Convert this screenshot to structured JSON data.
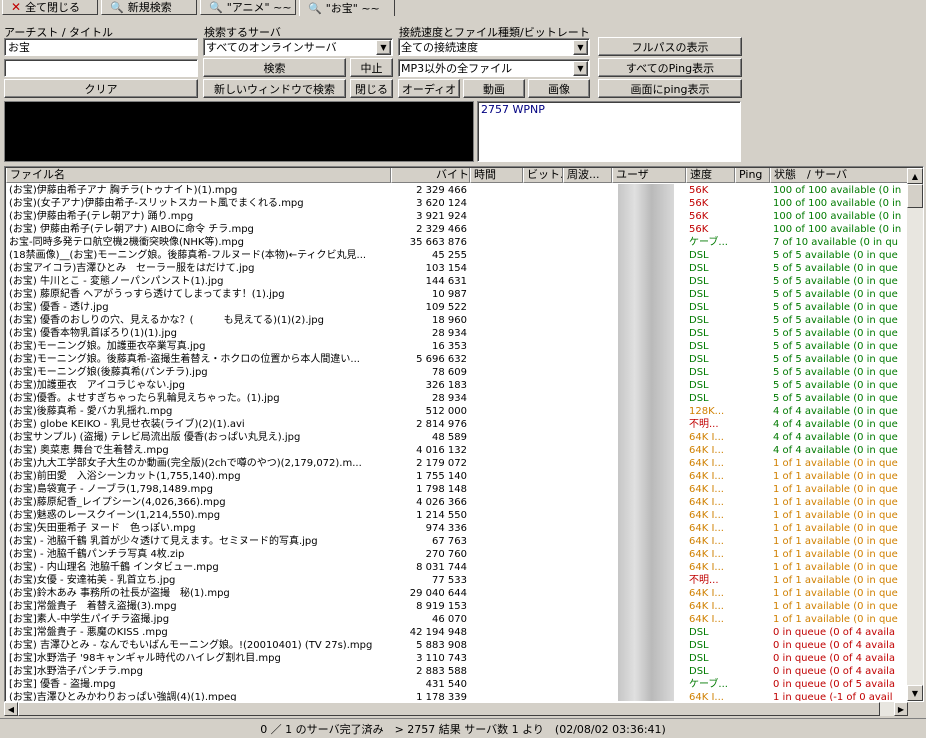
{
  "tabs": [
    {
      "label": "全て閉じる",
      "icon": "close-icon"
    },
    {
      "label": "新規検索",
      "icon": "search-icon"
    },
    {
      "label": "\"アニメ\" ~~",
      "icon": "search-icon"
    },
    {
      "label": "\"お宝\" ~~",
      "icon": "search-icon"
    }
  ],
  "search": {
    "artist_label": "アーチスト / タイトル",
    "artist_value": "お宝",
    "secondary_value": "",
    "clear_button": "クリア",
    "server_label": "検索するサーバ",
    "server_value": "すべてのオンラインサーバ",
    "search_button": "検索",
    "stop_button": "中止",
    "new_window_button": "新しいウィンドウで検索",
    "close_button": "閉じる",
    "speed_label": "接続速度とファイル種類/ビットレート",
    "speed_value": "全ての接続速度",
    "filetype_value": "MP3以外の全ファイル",
    "audio_button": "オーディオ",
    "video_button": "動画",
    "image_button": "画像",
    "fullpath_button": "フルパスの表示",
    "ping_all_button": "すべてのPing表示",
    "ping_screen_button": "画面にping表示",
    "info_text": "2757 WPNP"
  },
  "columns": [
    "ファイル名",
    "バイト",
    "時間",
    "ビット...",
    "周波...",
    "ユーザ",
    "速度",
    "Ping",
    "状態　/ サーバ"
  ],
  "colors": {
    "red": "#c00000",
    "green": "#007a00",
    "orange": "#d08000"
  },
  "rows": [
    {
      "name": "(お宝)伊藤由希子アナ 胸チラ(トゥナイト)(1).mpg",
      "size": "2 329 466",
      "speed": "56K",
      "speed_color": "red",
      "status": "100 of 100 available (0 in",
      "status_color": "green"
    },
    {
      "name": "(お宝)(女子アナ)伊藤由希子-スリットスカート風でまくれる.mpg",
      "size": "3 620 124",
      "speed": "56K",
      "speed_color": "red",
      "status": "100 of 100 available (0 in",
      "status_color": "green"
    },
    {
      "name": "(お宝)伊藤由希子(テレ朝アナ) 踊り.mpg",
      "size": "3 921 924",
      "speed": "56K",
      "speed_color": "red",
      "status": "100 of 100 available (0 in",
      "status_color": "green"
    },
    {
      "name": "(お宝) 伊藤由希子(テレ朝アナ) AIBOに命令 チラ.mpg",
      "size": "2 329 466",
      "speed": "56K",
      "speed_color": "red",
      "status": "100 of 100 available (0 in",
      "status_color": "green"
    },
    {
      "name": "お宝-同時多発テロ航空機2機衝突映像(NHK等).mpg",
      "size": "35 663 876",
      "speed": "ケーブ...",
      "speed_color": "green",
      "status": "7 of 10 available (0 in qu",
      "status_color": "green"
    },
    {
      "name": "(18禁画像)__(お宝)モーニング娘。後藤真希-フルヌード(本物)←ティクビ丸見...",
      "size": "45 255",
      "speed": "DSL",
      "speed_color": "green",
      "status": "5 of 5 available (0 in que",
      "status_color": "green"
    },
    {
      "name": "(お宝アイコラ)吉澤ひとみ　セーラー服をはだけて.jpg",
      "size": "103 154",
      "speed": "DSL",
      "speed_color": "green",
      "status": "5 of 5 available (0 in que",
      "status_color": "green"
    },
    {
      "name": "(お宝) 牛川とこ - 変態ノーパンパンスト(1).jpg",
      "size": "144 631",
      "speed": "DSL",
      "speed_color": "green",
      "status": "5 of 5 available (0 in que",
      "status_color": "green"
    },
    {
      "name": "(お宝) 藤原紀香 ヘアがうっすら透けてしまってます！(1).jpg",
      "size": "10 987",
      "speed": "DSL",
      "speed_color": "green",
      "status": "5 of 5 available (0 in que",
      "status_color": "green"
    },
    {
      "name": "(お宝) 優香 - 透け.jpg",
      "size": "109 522",
      "speed": "DSL",
      "speed_color": "green",
      "status": "5 of 5 available (0 in que",
      "status_color": "green"
    },
    {
      "name": "(お宝) 優香のおしりの穴、見えるかな？(　　　も見えてる)(1)(2).jpg",
      "size": "18 960",
      "speed": "DSL",
      "speed_color": "green",
      "status": "5 of 5 available (0 in que",
      "status_color": "green"
    },
    {
      "name": "(お宝) 優香本物乳首ぽろり(1)(1).jpg",
      "size": "28 934",
      "speed": "DSL",
      "speed_color": "green",
      "status": "5 of 5 available (0 in que",
      "status_color": "green"
    },
    {
      "name": "(お宝)モーニング娘。加護亜衣卒業写真.jpg",
      "size": "16 353",
      "speed": "DSL",
      "speed_color": "green",
      "status": "5 of 5 available (0 in que",
      "status_color": "green"
    },
    {
      "name": "(お宝)モーニング娘。後藤真希-盗撮生着替え・ホクロの位置から本人間違い...",
      "size": "5 696 632",
      "speed": "DSL",
      "speed_color": "green",
      "status": "5 of 5 available (0 in que",
      "status_color": "green"
    },
    {
      "name": "(お宝)モーニング娘(後藤真希(パンチラ).jpg",
      "size": "78 609",
      "speed": "DSL",
      "speed_color": "green",
      "status": "5 of 5 available (0 in que",
      "status_color": "green"
    },
    {
      "name": "(お宝)加護亜衣　アイコラじゃない.jpg",
      "size": "326 183",
      "speed": "DSL",
      "speed_color": "green",
      "status": "5 of 5 available (0 in que",
      "status_color": "green"
    },
    {
      "name": "(お宝)優香。よせすぎちゃったら乳輪見えちゃった。(1).jpg",
      "size": "28 934",
      "speed": "DSL",
      "speed_color": "green",
      "status": "5 of 5 available (0 in que",
      "status_color": "green"
    },
    {
      "name": "(お宝)後藤真希 - 愛バカ乳揺れ.mpg",
      "size": "512 000",
      "speed": "128K...",
      "speed_color": "orange",
      "status": "4 of 4 available (0 in que",
      "status_color": "green"
    },
    {
      "name": "(お宝) globe KEIKO - 乳見せ衣装(ライブ)(2)(1).avi",
      "size": "2 814 976",
      "speed": "不明...",
      "speed_color": "red",
      "status": "4 of 4 available (0 in que",
      "status_color": "green"
    },
    {
      "name": "(お宝サンプル) (盗撮) テレビ局流出版 優香(おっぱい丸見え).jpg",
      "size": "48 589",
      "speed": "64K I...",
      "speed_color": "orange",
      "status": "4 of 4 available (0 in que",
      "status_color": "green"
    },
    {
      "name": "(お宝) 奥菜恵 舞台で生着替え.mpg",
      "size": "4 016 132",
      "speed": "64K I...",
      "speed_color": "orange",
      "status": "4 of 4 available (0 in que",
      "status_color": "green"
    },
    {
      "name": "(お宝)九大工学部女子大生のか動画(完全版)(2chで噂のやつ)(2,179,072).m...",
      "size": "2 179 072",
      "speed": "64K I...",
      "speed_color": "orange",
      "status": "1 of 1 available (0 in que",
      "status_color": "orange"
    },
    {
      "name": "(お宝)前田愛　入浴シーンカット(1,755,140).mpg",
      "size": "1 755 140",
      "speed": "64K I...",
      "speed_color": "orange",
      "status": "1 of 1 available (0 in que",
      "status_color": "orange"
    },
    {
      "name": "(お宝)島袋寛子 - ノーブラ(1,798,1489.mpg",
      "size": "1 798 148",
      "speed": "64K I...",
      "speed_color": "orange",
      "status": "1 of 1 available (0 in que",
      "status_color": "orange"
    },
    {
      "name": "(お宝)藤原紀香_レイプシーン(4,026,366).mpg",
      "size": "4 026 366",
      "speed": "64K I...",
      "speed_color": "orange",
      "status": "1 of 1 available (0 in que",
      "status_color": "orange"
    },
    {
      "name": "(お宝)魅惑のレースクイーン(1,214,550).mpg",
      "size": "1 214 550",
      "speed": "64K I...",
      "speed_color": "orange",
      "status": "1 of 1 available (0 in que",
      "status_color": "orange"
    },
    {
      "name": "(お宝)矢田亜希子 ヌード　色っぽい.mpg",
      "size": "974 336",
      "speed": "64K I...",
      "speed_color": "orange",
      "status": "1 of 1 available (0 in que",
      "status_color": "orange"
    },
    {
      "name": "(お宝) - 池脇千鶴 乳首が少々透けて見えます。セミヌード的写真.jpg",
      "size": "67 763",
      "speed": "64K I...",
      "speed_color": "orange",
      "status": "1 of 1 available (0 in que",
      "status_color": "orange"
    },
    {
      "name": "(お宝) - 池脇千鶴パンチラ写真 4枚.zip",
      "size": "270 760",
      "speed": "64K I...",
      "speed_color": "orange",
      "status": "1 of 1 available (0 in que",
      "status_color": "orange"
    },
    {
      "name": "(お宝) - 内山理名 池脇千鶴 インタビュー.mpg",
      "size": "8 031 744",
      "speed": "64K I...",
      "speed_color": "orange",
      "status": "1 of 1 available (0 in que",
      "status_color": "orange"
    },
    {
      "name": "(お宝)女優 - 安達祐美 - 乳首立ち.jpg",
      "size": "77 533",
      "speed": "不明...",
      "speed_color": "red",
      "status": "1 of 1 available (0 in que",
      "status_color": "orange"
    },
    {
      "name": "(お宝)鈴木あみ 事務所の社長が盗撮　秘(1).mpg",
      "size": "29 040 644",
      "speed": "64K I...",
      "speed_color": "orange",
      "status": "1 of 1 available (0 in que",
      "status_color": "orange"
    },
    {
      "name": "[お宝]常盤貴子　着替え盗撮(3).mpg",
      "size": "8 919 153",
      "speed": "64K I...",
      "speed_color": "orange",
      "status": "1 of 1 available (0 in que",
      "status_color": "orange"
    },
    {
      "name": "[お宝]素人-中学生パイチラ盗撮.jpg",
      "size": "46 070",
      "speed": "64K I...",
      "speed_color": "orange",
      "status": "1 of 1 available (0 in que",
      "status_color": "orange"
    },
    {
      "name": "[お宝]常盤貴子 - 悪魔のKISS .mpg",
      "size": "42 194 948",
      "speed": "DSL",
      "speed_color": "green",
      "status": "0 in queue (0 of 4 availa",
      "status_color": "red"
    },
    {
      "name": "(お宝) 吉澤ひとみ - なんでもいばんモーニング娘。!(20010401) (TV 27s).mpg",
      "size": "5 883 908",
      "speed": "DSL",
      "speed_color": "green",
      "status": "0 in queue (0 of 4 availa",
      "status_color": "red"
    },
    {
      "name": "[お宝]水野浩子 '98キャンギャル時代のハイレグ割れ目.mpg",
      "size": "3 110 743",
      "speed": "DSL",
      "speed_color": "green",
      "status": "0 in queue (0 of 4 availa",
      "status_color": "red"
    },
    {
      "name": "[お宝]水野浩子パンチラ.mpg",
      "size": "2 883 588",
      "speed": "DSL",
      "speed_color": "green",
      "status": "0 in queue (0 of 4 availa",
      "status_color": "red"
    },
    {
      "name": "[お宝] 優香 - 盗撮.mpg",
      "size": "431 540",
      "speed": "ケーブ...",
      "speed_color": "green",
      "status": "0 in queue (0 of 5 availa",
      "status_color": "red"
    },
    {
      "name": "(お宝)吉澤ひとみかわりおっぱい強調(4)(1).mpeg",
      "size": "1 178 339",
      "speed": "64K I...",
      "speed_color": "orange",
      "status": "1 in queue (-1 of 0 avail",
      "status_color": "red"
    }
  ],
  "status_bar": "0 ／ 1 のサーバ完了済み　> 2757 結果  サーバ数 1 より　(02/08/02 03:36:41)"
}
